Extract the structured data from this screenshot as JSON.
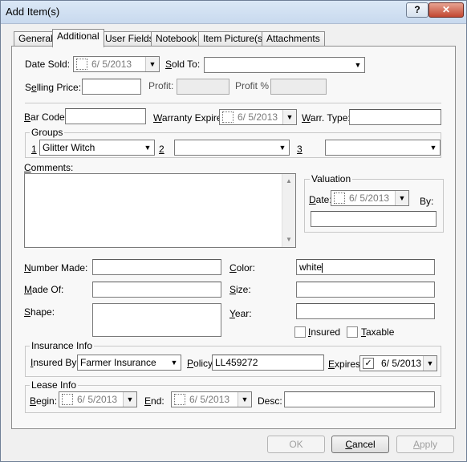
{
  "window": {
    "title": "Add Item(s)",
    "help_label": "?",
    "close_label": "✕"
  },
  "tabs": [
    {
      "label": "General"
    },
    {
      "label": "Additional"
    },
    {
      "label": "User Fields"
    },
    {
      "label": "Notebook"
    },
    {
      "label": "Item Picture(s)"
    },
    {
      "label": "Attachments"
    }
  ],
  "sale": {
    "date_sold_label": "Date Sold:",
    "date_sold_value": "6/ 5/2013",
    "sold_to_label": "Sold To:",
    "sold_to_value": "",
    "selling_price_label": "Selling Price:",
    "selling_price_value": "",
    "profit_label": "Profit:",
    "profit_value": "",
    "profit_pct_label": "Profit %",
    "profit_pct_value": ""
  },
  "barcode": {
    "bar_code_label": "Bar Code:",
    "bar_code_value": "",
    "warranty_label": "Warranty Expire:",
    "warranty_value": "6/ 5/2013",
    "warr_type_label": "Warr. Type:",
    "warr_type_value": ""
  },
  "groups": {
    "title": "Groups",
    "g1_label": "1",
    "g1_value": "Glitter Witch",
    "g2_label": "2",
    "g2_value": "",
    "g3_label": "3",
    "g3_value": ""
  },
  "comments": {
    "label": "Comments:",
    "value": ""
  },
  "valuation": {
    "title": "Valuation",
    "date_label": "Date:",
    "date_value": "6/ 5/2013",
    "by_label": "By:",
    "by_value": ""
  },
  "details": {
    "number_made_label": "Number Made:",
    "number_made_value": "",
    "made_of_label": "Made Of:",
    "made_of_value": "",
    "shape_label": "Shape:",
    "shape_value": "",
    "color_label": "Color:",
    "color_value": "white",
    "size_label": "Size:",
    "size_value": "",
    "year_label": "Year:",
    "year_value": "",
    "insured_label": "Insured",
    "taxable_label": "Taxable"
  },
  "insurance": {
    "title": "Insurance Info",
    "insured_by_label": "Insured By:",
    "insured_by_value": "Farmer Insurance",
    "policy_label": "Policy:",
    "policy_value": "LL459272",
    "expires_label": "Expires:",
    "expires_value": "6/ 5/2013"
  },
  "lease": {
    "title": "Lease Info",
    "begin_label": "Begin:",
    "begin_value": "6/ 5/2013",
    "end_label": "End:",
    "end_value": "6/ 5/2013",
    "desc_label": "Desc:",
    "desc_value": ""
  },
  "buttons": {
    "ok": "OK",
    "cancel": "Cancel",
    "apply": "Apply"
  },
  "icons": {
    "dropdown": "▼",
    "checkmark": "✓",
    "scroll_up": "▲",
    "scroll_down": "▼"
  }
}
